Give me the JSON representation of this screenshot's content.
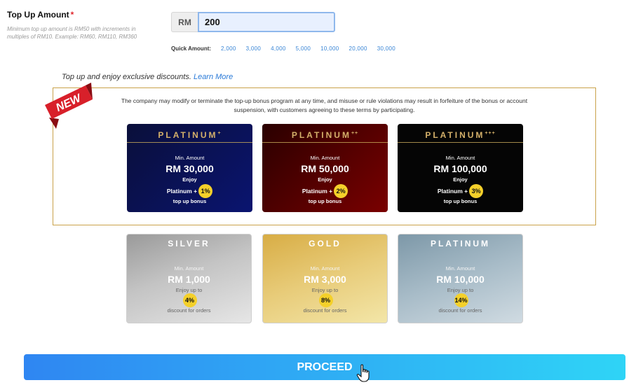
{
  "form": {
    "title": "Top Up Amount",
    "required_mark": "*",
    "hint": "Minimum top up amount is RM50 with increments in multiples of RM10. Example: RM60, RM110, RM360",
    "currency": "RM",
    "amount_value": "200",
    "quick_label": "Quick Amount:",
    "quick_options": [
      "2,000",
      "3,000",
      "4,000",
      "5,000",
      "10,000",
      "20,000",
      "30,000"
    ]
  },
  "promo": {
    "text": "Top up and enjoy exclusive discounts.",
    "link": "Learn More",
    "ribbon": "NEW",
    "terms": "The company may modify or terminate the top-up bonus program at any time, and misuse or rule violations may result in forfeiture of the bonus or account suspension, with customers agreeing to these terms by participating."
  },
  "premium_tiers": [
    {
      "name": "PLATINUM",
      "stars": "+",
      "min_label": "Min. Amount",
      "amount": "RM 30,000",
      "enjoy": "Enjoy",
      "plus_label": "Platinum +",
      "badge": "1%",
      "bonus": "top up bonus"
    },
    {
      "name": "PLATINUM",
      "stars": "++",
      "min_label": "Min. Amount",
      "amount": "RM 50,000",
      "enjoy": "Enjoy",
      "plus_label": "Platinum +",
      "badge": "2%",
      "bonus": "top up bonus"
    },
    {
      "name": "PLATINUM",
      "stars": "+++",
      "min_label": "Min. Amount",
      "amount": "RM 100,000",
      "enjoy": "Enjoy",
      "plus_label": "Platinum +",
      "badge": "3%",
      "bonus": "top up bonus"
    }
  ],
  "standard_tiers": [
    {
      "name": "SILVER",
      "min_label": "Min. Amount",
      "amount": "RM 1,000",
      "enjoy": "Enjoy up to",
      "badge": "4%",
      "bonus": "discount for orders"
    },
    {
      "name": "GOLD",
      "min_label": "Min. Amount",
      "amount": "RM 3,000",
      "enjoy": "Enjoy up to",
      "badge": "8%",
      "bonus": "discount for orders"
    },
    {
      "name": "PLATINUM",
      "min_label": "Min. Amount",
      "amount": "RM 10,000",
      "enjoy": "Enjoy up to",
      "badge": "14%",
      "bonus": "discount for orders"
    }
  ],
  "colors": {
    "accent_start": "#2f86f2",
    "accent_end": "#2fd4f6",
    "badge": "#f4d02a",
    "frame": "#c9a24a",
    "ribbon": "#d8202a"
  },
  "actions": {
    "proceed_label": "PROCEED"
  },
  "icons": {
    "cursor": "hand-pointer-icon"
  }
}
